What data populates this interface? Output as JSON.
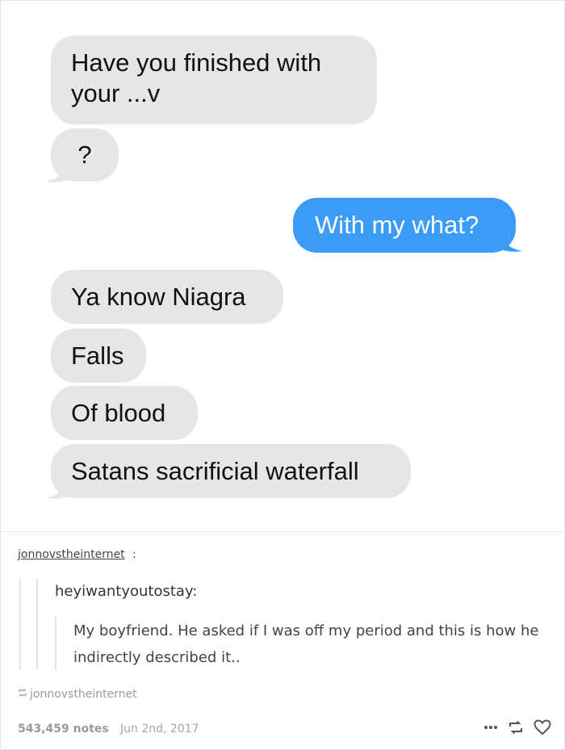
{
  "chat": {
    "messages": [
      {
        "from": "them",
        "text": "Have you finished with\nyour ...v"
      },
      {
        "from": "them",
        "text": "?"
      },
      {
        "from": "me",
        "text": "With my what?"
      },
      {
        "from": "them",
        "text": "Ya know Niagra"
      },
      {
        "from": "them",
        "text": "Falls"
      },
      {
        "from": "them",
        "text": "Of blood"
      },
      {
        "from": "them",
        "text": "Satans sacrificial waterfall"
      }
    ],
    "colors": {
      "received_bubble": "#e6e6e9",
      "sent_bubble": "#3b9cf8"
    }
  },
  "post": {
    "author": "jonnovstheinternet",
    "author_colon": ":",
    "reblogged_from": "heyiwantyoutostay:",
    "body": "My boyfriend. He asked if I was off my period and this is how he indirectly described it..",
    "source_label": "jonnovstheinternet",
    "source_icon": "reblog-icon"
  },
  "footer": {
    "notes": "543,459 notes",
    "date": "Jun 2nd, 2017",
    "icons": [
      "more-icon",
      "reblog-icon",
      "heart-icon"
    ]
  }
}
